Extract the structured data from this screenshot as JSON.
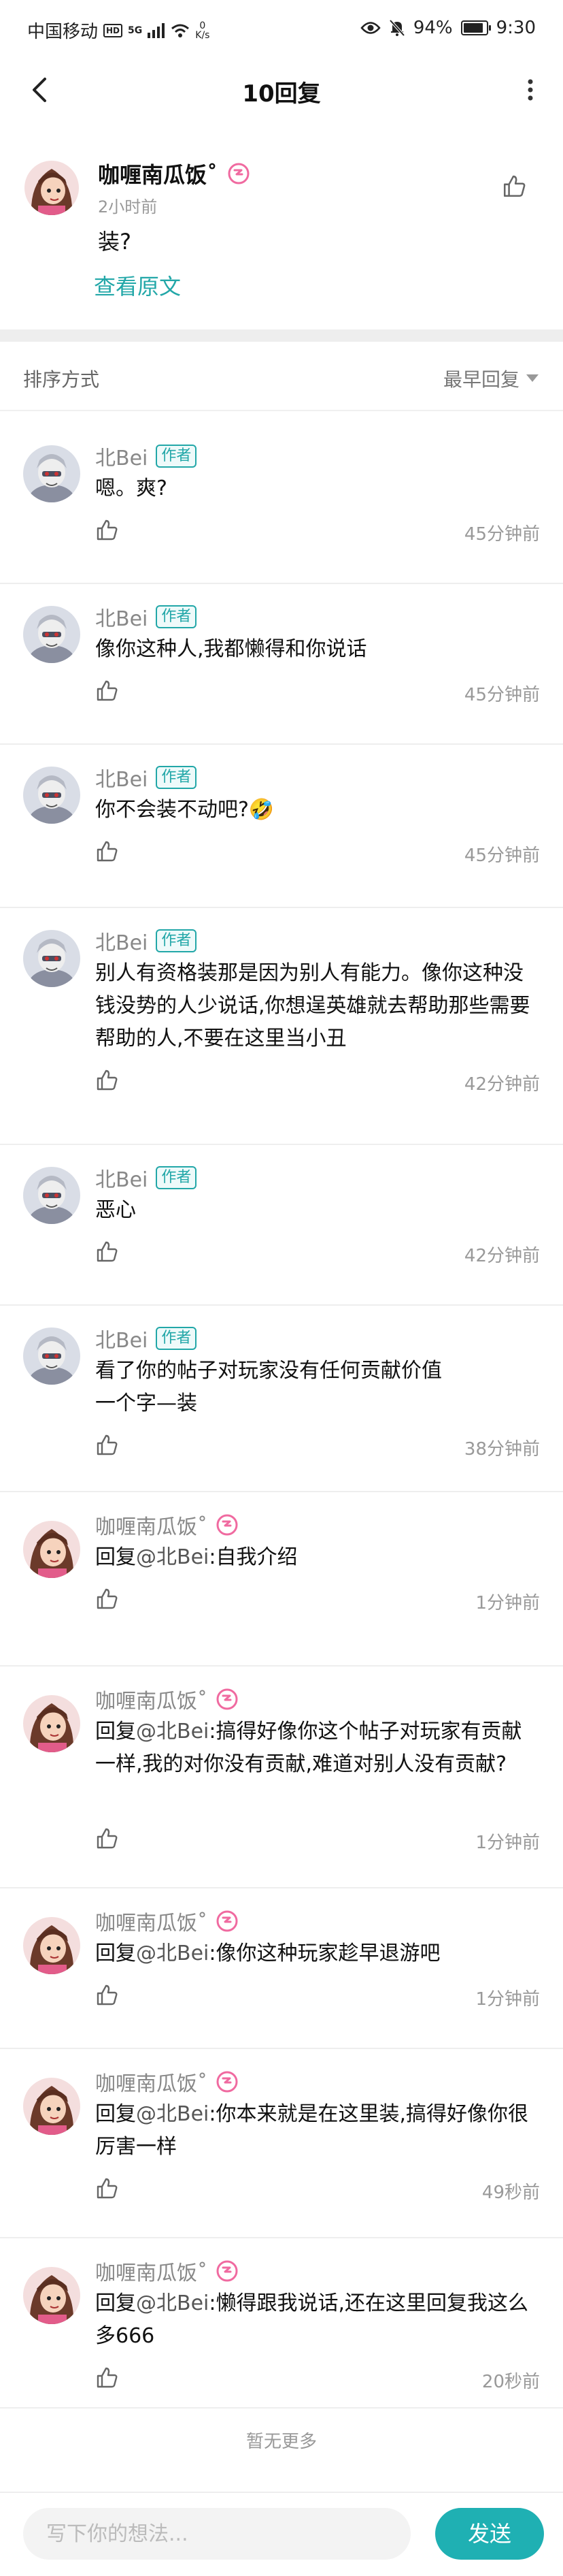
{
  "status_bar": {
    "carrier": "中国移动",
    "hd_badge": "HD",
    "network": "5G",
    "speed_value": "0",
    "speed_unit": "K/s",
    "battery": "94%",
    "time": "9:30"
  },
  "header": {
    "title": "10回复"
  },
  "original_post": {
    "author": "咖喱南瓜饭˚",
    "time": "2小时前",
    "text": "装?",
    "view_original": "查看原文"
  },
  "sort": {
    "label": "排序方式",
    "value": "最早回复"
  },
  "author_badge": "作者",
  "replies": [
    {
      "name": "北Bei",
      "is_author": true,
      "text": "嗯。爽?",
      "time": "45分钟前"
    },
    {
      "name": "北Bei",
      "is_author": true,
      "text": "像你这种人,我都懒得和你说话",
      "time": "45分钟前"
    },
    {
      "name": "北Bei",
      "is_author": true,
      "text": "你不会装不动吧?🤣",
      "time": "45分钟前"
    },
    {
      "name": "北Bei",
      "is_author": true,
      "text": "别人有资格装那是因为别人有能力。像你这种没钱没势的人少说话,你想逞英雄就去帮助那些需要帮助的人,不要在这里当小丑",
      "time": "42分钟前"
    },
    {
      "name": "北Bei",
      "is_author": true,
      "text": "恶心",
      "time": "42分钟前"
    },
    {
      "name": "北Bei",
      "is_author": true,
      "text": "看了你的帖子对玩家没有任何贡献价值\n一个字—装",
      "time": "38分钟前"
    },
    {
      "name": "咖喱南瓜饭˚",
      "is_author": false,
      "reply_prefix": "回复",
      "mention": "@北Bei",
      "text": ":自我介绍",
      "time": "1分钟前"
    },
    {
      "name": "咖喱南瓜饭˚",
      "is_author": false,
      "reply_prefix": "回复",
      "mention": "@北Bei",
      "text": ":搞得好像你这个帖子对玩家有贡献一样,我的对你没有贡献,难道对别人没有贡献?",
      "time": "1分钟前"
    },
    {
      "name": "咖喱南瓜饭˚",
      "is_author": false,
      "reply_prefix": "回复",
      "mention": "@北Bei",
      "text": ":像你这种玩家趁早退游吧",
      "time": "1分钟前"
    },
    {
      "name": "咖喱南瓜饭˚",
      "is_author": false,
      "reply_prefix": "回复",
      "mention": "@北Bei",
      "text": ":你本来就是在这里装,搞得好像你很厉害一样",
      "time": "49秒前"
    },
    {
      "name": "咖喱南瓜饭˚",
      "is_author": false,
      "reply_prefix": "回复",
      "mention": "@北Bei",
      "text": ":懒得跟我说话,还在这里回复我这么多666",
      "time": "20秒前"
    }
  ],
  "footer": {
    "no_more": "暂无更多"
  },
  "composer": {
    "placeholder": "写下你的想法...",
    "send_label": "发送"
  },
  "colors": {
    "accent": "#1fb0b3",
    "badge_pink": "#f06aa0"
  }
}
